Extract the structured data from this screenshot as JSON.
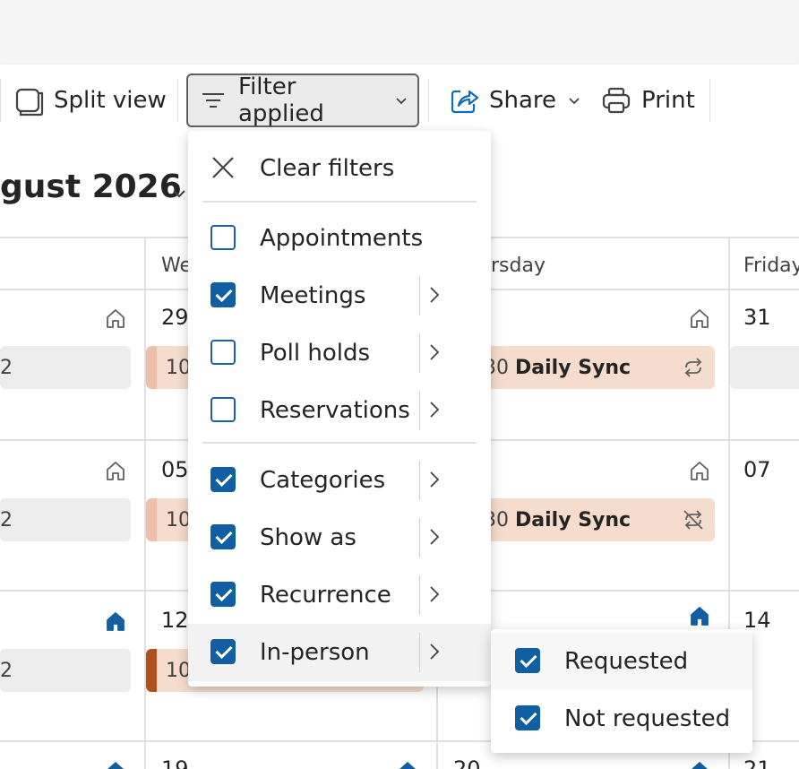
{
  "toolbar": {
    "split_view_label": "Split view",
    "filter_label": "Filter applied",
    "share_label": "Share",
    "print_label": "Print"
  },
  "calendar": {
    "month_title": "gust 2026",
    "day_headers": [
      "We",
      "rsday",
      "Friday"
    ],
    "weeks": [
      {
        "dates": [
          "29",
          "31"
        ]
      },
      {
        "dates": [
          "05",
          "07"
        ]
      },
      {
        "dates": [
          "12",
          "14"
        ]
      },
      {
        "dates": [
          "19",
          "20",
          "21"
        ]
      }
    ],
    "events": {
      "left_fragment": "2",
      "wed_fragment": "10",
      "thu_time_fragment": "30",
      "daily_sync": "Daily Sync"
    },
    "colors": {
      "accent": "#115ea3",
      "event_peach": "#f6dccd",
      "event_dark_bar": "#b0501f"
    }
  },
  "filter_menu": {
    "clear_label": "Clear filters",
    "items": [
      {
        "label": "Appointments",
        "checked": false,
        "has_submenu": false
      },
      {
        "label": "Meetings",
        "checked": true,
        "has_submenu": true
      },
      {
        "label": "Poll holds",
        "checked": false,
        "has_submenu": true
      },
      {
        "label": "Reservations",
        "checked": false,
        "has_submenu": true
      },
      {
        "label": "Categories",
        "checked": true,
        "has_submenu": true
      },
      {
        "label": "Show as",
        "checked": true,
        "has_submenu": true
      },
      {
        "label": "Recurrence",
        "checked": true,
        "has_submenu": true
      },
      {
        "label": "In-person",
        "checked": true,
        "has_submenu": true
      }
    ]
  },
  "inperson_submenu": {
    "items": [
      {
        "label": "Requested",
        "checked": true
      },
      {
        "label": "Not requested",
        "checked": true
      }
    ]
  }
}
